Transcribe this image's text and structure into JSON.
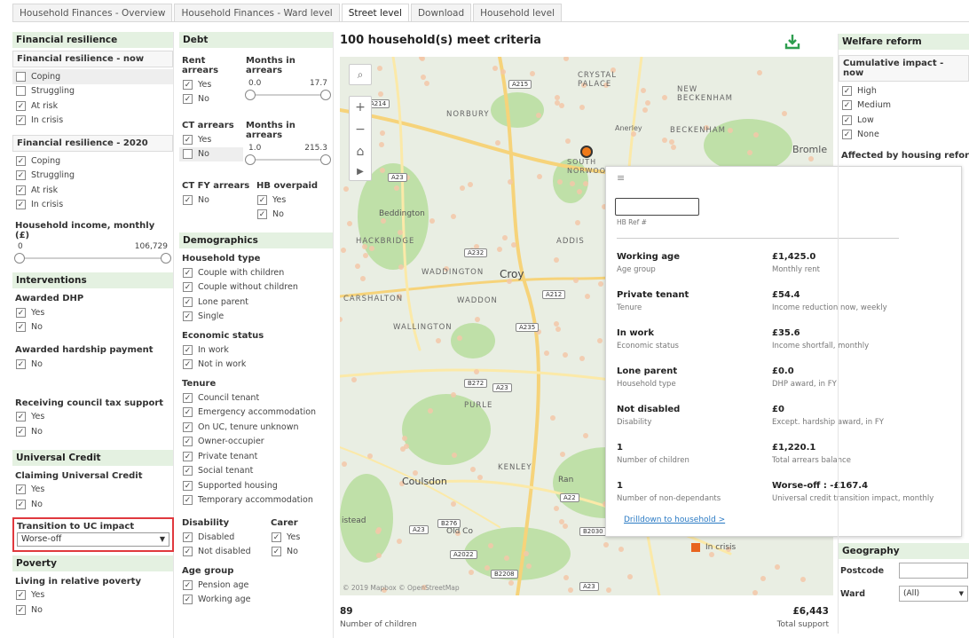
{
  "tabs": [
    "Household Finances - Overview",
    "Household Finances - Ward level",
    "Street level",
    "Download",
    "Household level"
  ],
  "fr": {
    "title": "Financial resilience",
    "now_title": "Financial resilience - now",
    "now_items": [
      "Coping",
      "Struggling",
      "At risk",
      "In crisis"
    ],
    "y2020_title": "Financial resilience - 2020",
    "y2020_items": [
      "Coping",
      "Struggling",
      "At risk",
      "In crisis"
    ],
    "income_title": "Household income, monthly (£)",
    "income_min": "0",
    "income_max": "106,729"
  },
  "interventions": {
    "title": "Interventions",
    "dhp_title": "Awarded DHP",
    "dhp_items": [
      "Yes",
      "No"
    ],
    "hardship_title": "Awarded hardship payment",
    "hardship_items": [
      "No"
    ],
    "ctsupport_title": "Receiving council tax support",
    "ctsupport_items": [
      "Yes",
      "No"
    ]
  },
  "uc": {
    "title": "Universal Credit",
    "claiming_title": "Claiming Universal Credit",
    "claiming_items": [
      "Yes",
      "No"
    ],
    "transition_title": "Transition to UC impact",
    "transition_value": "Worse-off"
  },
  "poverty": {
    "title": "Poverty",
    "relative_title": "Living in relative poverty",
    "items": [
      "Yes",
      "No"
    ]
  },
  "debt": {
    "title": "Debt",
    "rent_title": "Rent arrears",
    "rent_items": [
      "Yes",
      "No"
    ],
    "months_title": "Months in arrears",
    "months_min": "0.0",
    "months_max": "17.7",
    "ct_title": "CT arrears",
    "ct_items": [
      "Yes",
      "No"
    ],
    "ctmonths_title": "Months in arrears",
    "ctmonths_min": "1.0",
    "ctmonths_max": "215.3",
    "ctfy_title": "CT FY arrears",
    "ctfy_items": [
      "No"
    ],
    "hb_title": "HB overpaid",
    "hb_items": [
      "Yes",
      "No"
    ]
  },
  "demo": {
    "title": "Demographics",
    "hh_title": "Household type",
    "hh_items": [
      "Couple with children",
      "Couple without children",
      "Lone parent",
      "Single"
    ],
    "econ_title": "Economic status",
    "econ_items": [
      "In work",
      "Not in work"
    ],
    "tenure_title": "Tenure",
    "tenure_items": [
      "Council tenant",
      "Emergency accommodation",
      "On UC, tenure unknown",
      "Owner-occupier",
      "Private tenant",
      "Social tenant",
      "Supported housing",
      "Temporary accommodation"
    ],
    "dis_title": "Disability",
    "dis_items": [
      "Disabled",
      "Not disabled"
    ],
    "carer_title": "Carer",
    "carer_items": [
      "Yes",
      "No"
    ],
    "age_title": "Age group",
    "age_items": [
      "Pension age",
      "Working age"
    ]
  },
  "map": {
    "heading": "100 household(s) meet criteria",
    "attribution": "© 2019 Mapbox  © OpenStreetMap",
    "labels": [
      "NORBURY",
      "CRYSTAL PALACE",
      "NEW BECKENHAM",
      "BECKENHAM",
      "Bromle",
      "Beddington",
      "HACKBRIDGE",
      "WADDINGTON",
      "Croy",
      "CARSHALTON",
      "WADDON",
      "WALLINGTON",
      "PURLE",
      "Coulsdon",
      "KENLEY",
      "Old Co",
      "Anerley",
      "SOUTH NORWOOD",
      "ADDIS",
      "Ran",
      "istead"
    ],
    "roads": [
      "A215",
      "A214",
      "A23",
      "A232",
      "A212",
      "A235",
      "B272",
      "A23",
      "A22",
      "B276",
      "A23",
      "A2022",
      "B2030",
      "B2208",
      "A23"
    ],
    "legend_crisis": "In crisis"
  },
  "tooltip": {
    "ref_label": "HB Ref #",
    "rows": [
      {
        "lv": "Working age",
        "ll": "Age group",
        "rv": "£1,425.0",
        "rl": "Monthly rent"
      },
      {
        "lv": "Private tenant",
        "ll": "Tenure",
        "rv": "£54.4",
        "rl": "Income reduction now, weekly"
      },
      {
        "lv": "In work",
        "ll": "Economic status",
        "rv": "£35.6",
        "rl": "Income shortfall, monthly"
      },
      {
        "lv": "Lone parent",
        "ll": "Household type",
        "rv": "£0.0",
        "rl": "DHP award, in FY"
      },
      {
        "lv": "Not disabled",
        "ll": "Disability",
        "rv": "£0",
        "rl": "Except. hardship award, in FY"
      },
      {
        "lv": "1",
        "ll": "Number of children",
        "rv": "£1,220.1",
        "rl": "Total arrears balance"
      },
      {
        "lv": "1",
        "ll": "Number of non-dependants",
        "rv": "Worse-off : -£167.4",
        "rl": "Universal credit transition impact, monthly"
      }
    ],
    "drill": "Drilldown to household >"
  },
  "bottom": {
    "children_value": "89",
    "children_label": "Number of children",
    "support_value": "£6,443",
    "support_label": "Total support"
  },
  "welfare": {
    "title": "Welfare reform",
    "cum_title": "Cumulative impact - now",
    "items": [
      "High",
      "Medium",
      "Low",
      "None"
    ],
    "housing_title": "Affected by housing reform"
  },
  "geo": {
    "title": "Geography",
    "postcode_label": "Postcode",
    "ward_label": "Ward",
    "ward_value": "(All)"
  },
  "colors": {
    "accent": "#e4f1e1",
    "highlight": "#e0393e",
    "marker": "#f07a1a"
  }
}
